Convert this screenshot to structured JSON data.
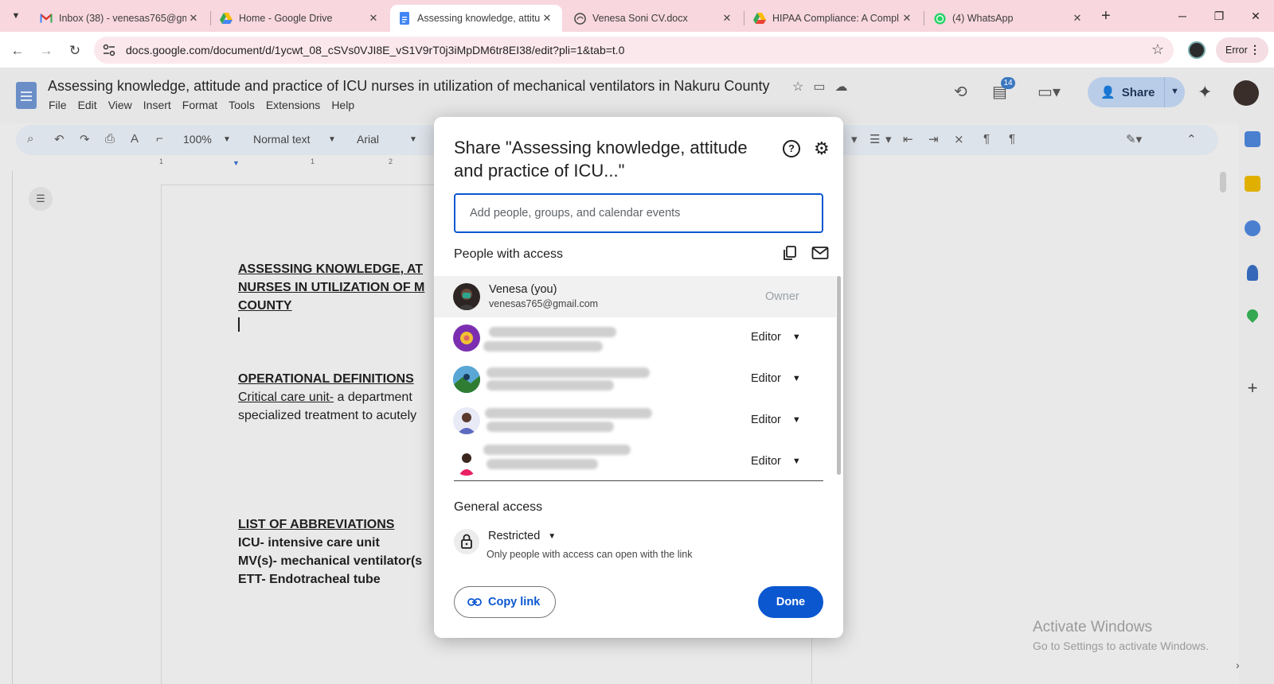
{
  "browser": {
    "tabs": [
      {
        "title": "Inbox (38) - venesas765@gm",
        "icon": "gmail-icon"
      },
      {
        "title": "Home - Google Drive",
        "icon": "drive-icon"
      },
      {
        "title": "Assessing knowledge, attitud",
        "icon": "docs-icon"
      },
      {
        "title": "Venesa Soni CV.docx",
        "icon": "globe-icon"
      },
      {
        "title": "HIPAA Compliance: A Compl",
        "icon": "drive-icon"
      },
      {
        "title": "(4) WhatsApp",
        "icon": "whatsapp-icon"
      }
    ],
    "url": "docs.google.com/document/d/1ycwt_08_cSVs0VJI8E_vS1V9rT0j3iMpDM6tr8EI38/edit?pli=1&tab=t.0",
    "profile_error": "Error"
  },
  "docs": {
    "title": "Assessing knowledge, attitude and practice of ICU nurses in utilization of mechanical ventilators in Nakuru County",
    "menu": [
      "File",
      "Edit",
      "View",
      "Insert",
      "Format",
      "Tools",
      "Extensions",
      "Help"
    ],
    "toolbar": {
      "zoom": "100%",
      "style": "Normal text",
      "font": "Arial"
    },
    "notifications_count": "14",
    "share_label": "Share",
    "ruler_labels": [
      "1",
      "1",
      "2"
    ],
    "body_lines": [
      "ASSESSING KNOWLEDGE, AT",
      "NURSES IN UTILIZATION OF M",
      "COUNTY",
      "OPERATIONAL DEFINITIONS",
      "Critical care unit-",
      " a department",
      "specialized treatment to acutely",
      "LIST OF ABBREVIATIONS",
      "ICU- intensive care unit",
      "MV(s)- mechanical ventilator(s",
      "ETT- Endotracheal tube"
    ]
  },
  "share_dialog": {
    "title": "Share \"Assessing knowledge, attitude and practice of ICU...\"",
    "input_placeholder": "Add people, groups, and calendar events",
    "people_label": "People with access",
    "people": [
      {
        "name": "Venesa (you)",
        "email": "venesas765@gmail.com",
        "role": "Owner"
      },
      {
        "name": "",
        "email": "",
        "role": "Editor"
      },
      {
        "name": "",
        "email": "",
        "role": "Editor"
      },
      {
        "name": "",
        "email": "",
        "role": "Editor"
      },
      {
        "name": "",
        "email": "",
        "role": "Editor"
      }
    ],
    "general_access_label": "General access",
    "access_level": "Restricted",
    "access_desc": "Only people with access can open with the link",
    "copy_link": "Copy link",
    "done": "Done"
  },
  "watermark": {
    "line1": "Activate Windows",
    "line2": "Go to Settings to activate Windows."
  },
  "colors": {
    "accent": "#0b57d0",
    "tabstrip": "#f8d7df",
    "dim": "#e9e9e9"
  }
}
